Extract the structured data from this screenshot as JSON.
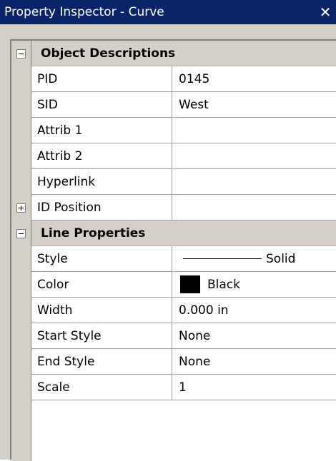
{
  "window": {
    "title": "Property Inspector - Curve",
    "close_glyph": "✕"
  },
  "sections": [
    {
      "label": "Object Descriptions",
      "expanded": true,
      "rows": [
        {
          "name": "PID",
          "value": "0145"
        },
        {
          "name": "SID",
          "value": "West"
        },
        {
          "name": "Attrib 1",
          "value": ""
        },
        {
          "name": "Attrib 2",
          "value": ""
        },
        {
          "name": "Hyperlink",
          "value": ""
        },
        {
          "name": "ID Position",
          "value": "",
          "collapsed_group": true
        }
      ]
    },
    {
      "label": "Line Properties",
      "expanded": true,
      "rows": [
        {
          "name": "Style",
          "value": "Solid"
        },
        {
          "name": "Color",
          "value": "Black",
          "swatch": "#000000"
        },
        {
          "name": "Width",
          "value": "0.000 in"
        },
        {
          "name": "Start Style",
          "value": "None"
        },
        {
          "name": "End Style",
          "value": "None"
        },
        {
          "name": "Scale",
          "value": "1"
        }
      ]
    }
  ],
  "colors": {
    "titlebar": "#0a246a",
    "face": "#d4d0c8",
    "grid_line": "#a0a0a0"
  }
}
